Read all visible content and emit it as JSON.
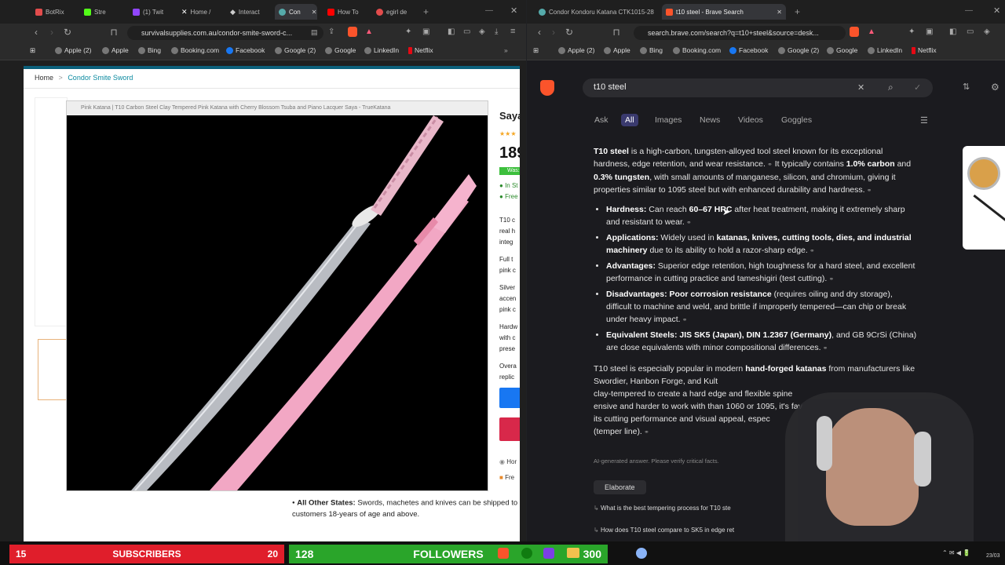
{
  "left_browser": {
    "tabs": [
      {
        "title": "BotRix",
        "color": "#e24c4c"
      },
      {
        "title": "Stre",
        "color": "#53fc18"
      },
      {
        "title": "(1) Twit",
        "color": "#9146ff"
      },
      {
        "title": "Home /",
        "color": "#ffffff"
      },
      {
        "title": "Interact",
        "color": "#cccccc"
      },
      {
        "title": "Con",
        "color": "#5aa"
      },
      {
        "title": "How To",
        "color": "#ff0000"
      },
      {
        "title": "egirl de",
        "color": "#e24c4c"
      }
    ],
    "url": "survivalsupplies.com.au/condor-smite-sword-c...",
    "bookmarks": [
      "Apple (2)",
      "Apple",
      "Bing",
      "Booking.com",
      "Facebook",
      "Google (2)",
      "Google",
      "LinkedIn",
      "Netflix"
    ],
    "breadcrumb_home": "Home",
    "breadcrumb_sep": ">",
    "breadcrumb_current": "Condor Smite Sword",
    "image_caption": "Pink Katana | T10 Carbon Steel Clay Tempered Pink Katana with Cherry Blossom Tsuba and Piano Lacquer Saya - TrueKatana",
    "product_heading_fragment": "Saya",
    "price_fragment": "189",
    "was_fragment": "Was:",
    "in_stock": "In St",
    "free_fragment": "Free",
    "features": [
      "T10 c",
      "real h",
      "integ",
      "Full t",
      "pink c",
      "Silver",
      "accen",
      "pink c",
      "Hardw",
      "with c",
      "prese",
      "Overa",
      "replic"
    ],
    "home_fragment": "Hor",
    "free2_fragment": "Fre",
    "shipping_label": "All Other States:",
    "shipping_text": " Swords, machetes and knives can be shipped to customers 18-years of age and above."
  },
  "right_browser": {
    "tabs": [
      {
        "title": "Condor Kondoru Katana CTK1015-28",
        "color": "#5aa"
      },
      {
        "title": "t10 steel - Brave Search",
        "color": "#fb542b"
      }
    ],
    "url": "search.brave.com/search?q=t10+steel&source=desk...",
    "bookmarks": [
      "Apple (2)",
      "Apple",
      "Bing",
      "Booking.com",
      "Facebook",
      "Google (2)",
      "Google",
      "LinkedIn",
      "Netflix"
    ],
    "query": "t10 steel",
    "search_tabs": [
      "Ask",
      "All",
      "Images",
      "News",
      "Videos",
      "Goggles"
    ],
    "answer": {
      "intro_bold": "T10 steel",
      "intro_1": " is a high-carbon, tungsten-alloyed tool steel known for its exceptional hardness, edge retention, and wear resistance.",
      "intro_2": " It typically contains ",
      "carbon": "1.0% carbon",
      "and": " and ",
      "tungsten": "0.3% tungsten",
      "intro_3": ", with small amounts of manganese, silicon, and chromium, giving it properties similar to 1095 steel but with enhanced durability and hardness.",
      "bullets": [
        {
          "label": "Hardness:",
          "text": " Can reach ",
          "bold": "60–67 HRC",
          "rest": " after heat treatment, making it extremely sharp and resistant to wear."
        },
        {
          "label": "Applications:",
          "text": " Widely used in ",
          "bold": "katanas, knives, cutting tools, dies, and industrial machinery",
          "rest": " due to its ability to hold a razor-sharp edge."
        },
        {
          "label": "Advantages:",
          "text": " Superior edge retention, high toughness for a hard steel, and excellent performance in cutting practice and tameshigiri (test cutting).",
          "bold": "",
          "rest": ""
        },
        {
          "label": "Disadvantages:",
          "text": " ",
          "bold": "Poor corrosion resistance",
          "rest": " (requires oiling and dry storage), difficult to machine and weld, and brittle if improperly tempered—can chip or break under heavy impact."
        },
        {
          "label": "Equivalent Steels:",
          "text": " ",
          "bold": "JIS SK5 (Japan), DIN 1.2367 (Germany)",
          "rest": ", and GB 9CrSi (China) are close equivalents with minor compositional differences."
        }
      ],
      "para2_1": "T10 steel is especially popular in modern ",
      "para2_bold": "hand-forged katanas",
      "para2_2": " from manufacturers like Swordier, Hanbon Forge, and Kult",
      "para2_3": " clay-tempered to create a hard edge and flexible spine",
      "para2_4": "ensive and harder to work with than 1060 or 1095, it's fav",
      "para2_5": "its cutting performance and visual appeal, espec",
      "para2_6": "(temper line)."
    },
    "disclaimer": "AI-generated answer. Please verify critical facts.",
    "elaborate": "Elaborate",
    "suggestions": [
      "What is the best tempering process for T10 ste",
      "How does T10 steel compare to SK5 in edge ret"
    ]
  },
  "overlay": {
    "sub_left": "15",
    "sub_label": "SUBSCRIBERS",
    "sub_right": "20",
    "fol_left": "128",
    "fol_label": "FOLLOWERS",
    "fol_right": "300",
    "sub_color": "#e01e2b",
    "fol_color": "#2aa52a"
  },
  "taskbar": {
    "time": "23/03"
  }
}
